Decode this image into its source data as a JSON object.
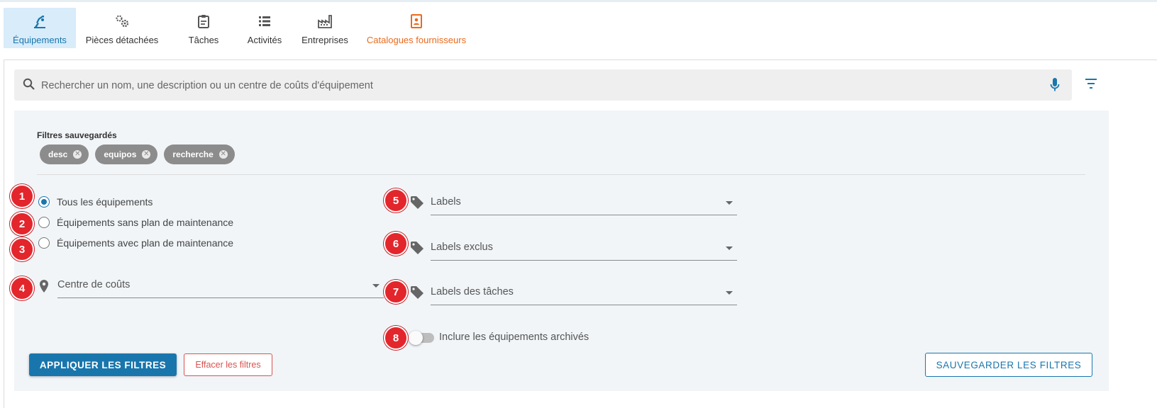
{
  "tabs": [
    {
      "label": "Équipements",
      "icon": "equipment-icon",
      "active": true
    },
    {
      "label": "Pièces détachées",
      "icon": "gears-icon"
    },
    {
      "label": "Tâches",
      "icon": "clipboard-icon"
    },
    {
      "label": "Activités",
      "icon": "list-icon"
    },
    {
      "label": "Entreprises",
      "icon": "factory-icon"
    },
    {
      "label": "Catalogues fournisseurs",
      "icon": "catalog-icon"
    }
  ],
  "search": {
    "placeholder": "Rechercher un nom, une description ou un centre de coûts d'équipement"
  },
  "saved_filters": {
    "label": "Filtres sauvegardés",
    "chips": [
      "desc",
      "equipos",
      "recherche"
    ]
  },
  "radios": [
    {
      "label": "Tous les équipements",
      "checked": true
    },
    {
      "label": "Équipements sans plan de maintenance",
      "checked": false
    },
    {
      "label": "Équipements avec plan de maintenance",
      "checked": false
    }
  ],
  "selects": {
    "cost_center": "Centre de coûts",
    "labels": "Labels",
    "excluded_labels": "Labels exclus",
    "task_labels": "Labels des tâches"
  },
  "toggle": {
    "label": "Inclure les équipements archivés",
    "on": false
  },
  "badges": [
    "1",
    "2",
    "3",
    "4",
    "5",
    "6",
    "7",
    "8"
  ],
  "buttons": {
    "apply": "APPLIQUER LES FILTRES",
    "clear": "Effacer les filtres",
    "save": "SAUVEGARDER LES FILTRES"
  },
  "colors": {
    "primary": "#1976ad",
    "accent_orange": "#ea6a1c",
    "badge_red": "#e3262c",
    "clear_red": "#d9534f"
  }
}
